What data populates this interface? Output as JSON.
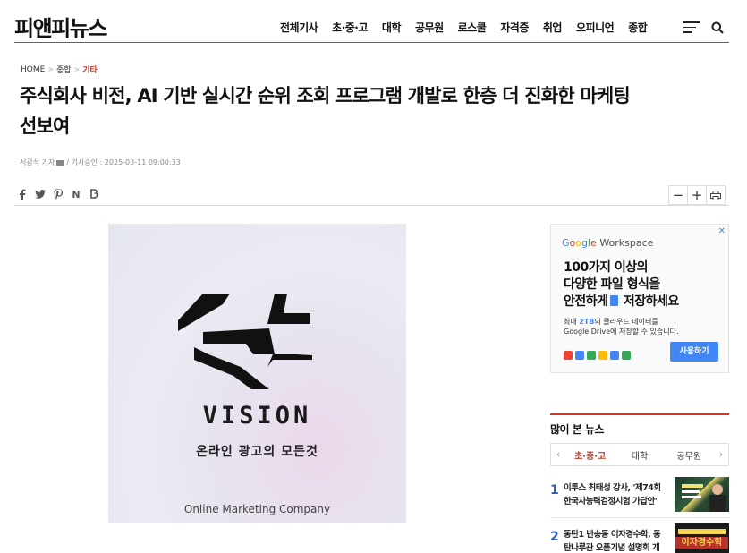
{
  "site": {
    "logo": "피앤피뉴스"
  },
  "nav": {
    "items": [
      "전체기사",
      "초·중·고",
      "대학",
      "공무원",
      "로스쿨",
      "자격증",
      "취업",
      "오피니언",
      "종합"
    ]
  },
  "breadcrumb": {
    "home": "HOME",
    "section": "종합",
    "current": "기타"
  },
  "article": {
    "title_line1": "주식회사 비전, AI 기반 실시간 순위 조회 프로그램 개발로 한층 더 진화한 마케팅",
    "title_line2": "선보여",
    "author": "서광석 기자",
    "approved": "/ 기사승인 : 2025-03-11 09:00:33"
  },
  "share": {
    "icons": [
      "facebook-icon",
      "twitter-icon",
      "pinterest-icon",
      "naver-icon",
      "band-icon"
    ]
  },
  "tools": {
    "zoom_out": "−",
    "zoom_in": "+",
    "print": "⎙"
  },
  "image": {
    "brand": "VISION",
    "tagline_kr": "온라인 광고의 모든것",
    "tagline_en": "Online Marketing Company"
  },
  "ad": {
    "close": "✕",
    "brand_g": "G",
    "brand_o1": "o",
    "brand_o2": "o",
    "brand_g2": "g",
    "brand_l": "l",
    "brand_e": "e",
    "brand_suffix": " Workspace",
    "headline_1": "100가지 이상의",
    "headline_2": "다양한 파일 형식을",
    "headline_3a": "안전하게",
    "headline_3b": " 저장하세요",
    "sub_1": "최대 ",
    "sub_hl": "2TB",
    "sub_2": "의 클라우드 데이터를",
    "sub_3": "Google Drive에 저장할 수 있습니다.",
    "button": "사용하기",
    "app_colors": [
      "#ea4335",
      "#4285f4",
      "#34a853",
      "#fbbc05",
      "#4285f4",
      "#34a853"
    ]
  },
  "popular": {
    "title": "많이 본 뉴스",
    "prev": "‹",
    "next": "›",
    "tabs": [
      "초·중·고",
      "대학",
      "공무원"
    ],
    "items": [
      {
        "rank": "1",
        "text": "이투스 최태성 강사, '제74회 한국사능력검정시험 가답안'"
      },
      {
        "rank": "2",
        "text": "동탄1 반송동 이자경수학, 동탄나루관 오픈기념 설명회 개"
      }
    ],
    "thumb2_text": "이자경수학"
  },
  "colors": {
    "accent": "#cc3a28",
    "link_blue": "#2a5db0",
    "google_blue": "#4285f4"
  }
}
